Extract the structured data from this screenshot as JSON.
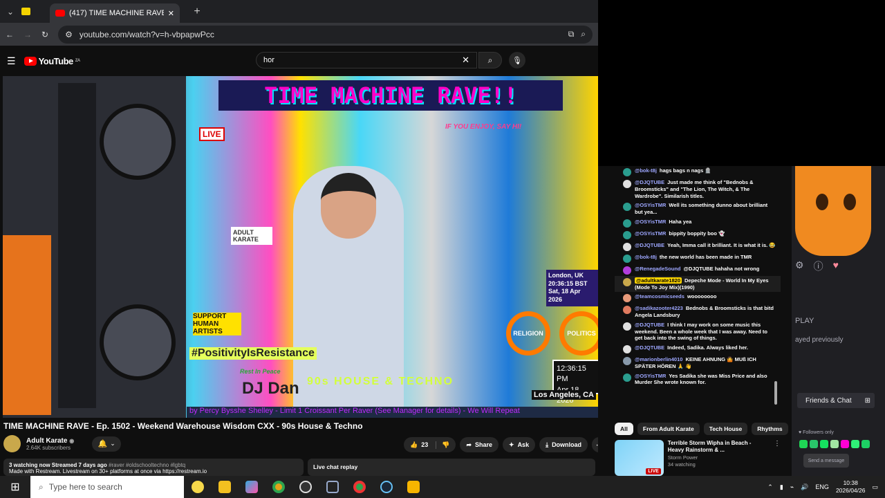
{
  "browser": {
    "tab_title": "(417) TIME MACHINE RAVE",
    "url": "youtube.com/watch?v=h-vbpapwPcc"
  },
  "youtube": {
    "logo_text": "YouTube",
    "logo_sup": "ZA",
    "search_value": "hor"
  },
  "video_overlay": {
    "poster_title": "TIME MACHINE RAVE!!",
    "live": "LIVE",
    "if_you_enjoy": "IF YOU ENJOY, SAY HI!",
    "adult_karate": "ADULT KARATE",
    "support": "SUPPORT HUMAN ARTISTS",
    "hashtag": "#PositivityIsResistance",
    "rip": "Rest In Peace",
    "dj": "DJ Dan",
    "genre": "90s HOUSE & TECHNO",
    "london": "London, UK",
    "london_time": "20:36:15 BST",
    "london_date": "Sat, 18 Apr 2026",
    "la_time": "12:36:15 PM",
    "la_date": "Apr 18, 2026",
    "la": "Los Angeles, CA",
    "religion": "RELIGION",
    "politics": "POLITICS",
    "ticker": "by Percy Bysshe Shelley - Limit 1 Croissant Per Raver (See Manager for details) - We Will Repeat"
  },
  "video": {
    "title": "TIME MACHINE RAVE - Ep. 1502 - Weekend Warehouse Wisdom CXX - 90s House & Techno",
    "channel": "Adult Karate",
    "subscribers": "2.64K subscribers",
    "likes": "23",
    "share": "Share",
    "ask": "Ask",
    "download": "Download",
    "meta": "3 watching now  Streamed 7 days ago",
    "tags": "#raver #oldschooltechno #lgbtq",
    "desc_line2": "Made with Restream. Livestream on 30+ platforms at once via https://restream.io",
    "live_chat_replay": "Live chat replay"
  },
  "chat": [
    {
      "author": "@bok-t8j",
      "text": "hags bags n nags 🪦",
      "color": "#2a9d8f"
    },
    {
      "author": "@DJQTUBE",
      "text": "Just made me think of \"Bednobs & Broomsticks\" and \"The Lion, The Witch, & The Wardrobe\". Similarish titles.",
      "color": "#e0e0e0"
    },
    {
      "author": "@OSYisTMR",
      "text": "Well its something dunno about brilliant but yea...",
      "color": "#2a9d8f"
    },
    {
      "author": "@OSYisTMR",
      "text": "Haha yea",
      "color": "#2a9d8f"
    },
    {
      "author": "@OSYisTMR",
      "text": "bippity boppity boo 👻",
      "color": "#2a9d8f"
    },
    {
      "author": "@DJQTUBE",
      "text": "Yeah, Imma call it brilliant. It is what it is. 😂",
      "color": "#e0e0e0"
    },
    {
      "author": "@bok-t8j",
      "text": "the new world has been made in TMR",
      "color": "#2a9d8f"
    },
    {
      "author": "@RenegadeSound",
      "text": "@DJQTUBE hahaha not wrong",
      "color": "#b13ddb"
    },
    {
      "author": "@adultkarate1820",
      "text": "Depeche Mode - World In My Eyes (Mode To Joy Mix)(1990)",
      "color": "#c9a84b",
      "highlight": true
    },
    {
      "author": "@teamcosmicseeds",
      "text": "woooooooo",
      "color": "#e89a7a"
    },
    {
      "author": "@sadikazooter4223",
      "text": "Bednobs & Broomsticks is that bitd Angela Landsbury",
      "color": "#e07a5f"
    },
    {
      "author": "@DJQTUBE",
      "text": "I think I may work on some music this weekend. Been a whole week that I was away. Need to get back into the swing of things.",
      "color": "#e0e0e0"
    },
    {
      "author": "@DJQTUBE",
      "text": "Indeed, Sadika. Always liked her.",
      "color": "#e0e0e0"
    },
    {
      "author": "@marionberlin4010",
      "text": "KEINE AHNUNG 🤷 MUß ICH SPÄTER HÖREN 🙏 👋",
      "color": "#8899aa"
    },
    {
      "author": "@OSYisTMR",
      "text": "Yes Sadika she was Miss Price and also Murder She wrote known for.",
      "color": "#2a9d8f"
    }
  ],
  "chips": [
    "All",
    "From Adult Karate",
    "Tech House",
    "Rhythms"
  ],
  "recommendation": {
    "title": "Terrible Storm Wipha in Beach - Heavy Rainstorm & ...",
    "channel": "Storm Power",
    "watching": "34 watching",
    "badge": "LIVE"
  },
  "twitch": {
    "play_label": "PLAY",
    "played_previously": "ayed previously",
    "friends": "Friends & Chat",
    "followers_only": "Followers only",
    "send": "Send a message"
  },
  "taskbar": {
    "search_placeholder": "Type here to search",
    "lang": "ENG",
    "time": "10:38",
    "date": "2026/04/26"
  }
}
